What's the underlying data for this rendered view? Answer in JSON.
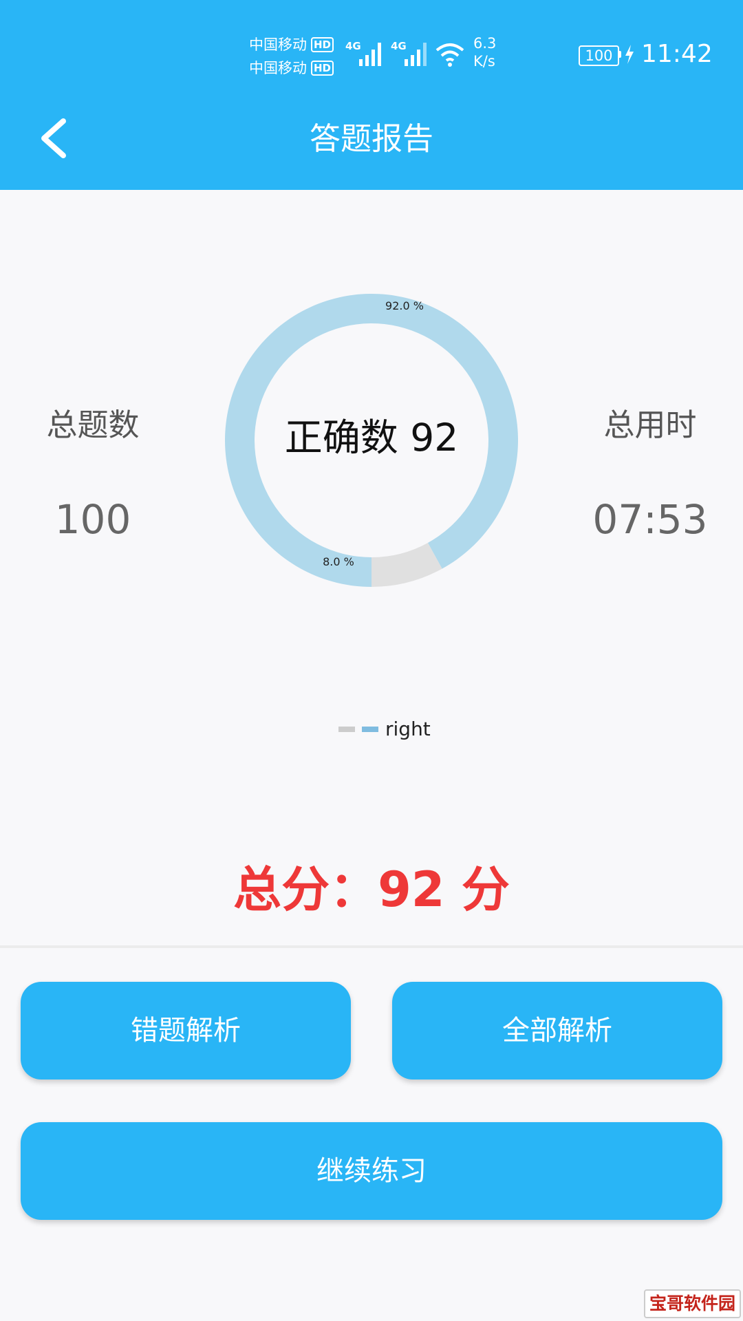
{
  "status_bar": {
    "carrier_1": "中国移动",
    "carrier_2": "中国移动",
    "hd_badge": "HD",
    "network_1": "4G",
    "network_2": "4G",
    "speed_value": "6.3",
    "speed_unit": "K/s",
    "battery": "100",
    "time": "11:42"
  },
  "header": {
    "title": "答题报告",
    "back_icon": "chevron-left-icon"
  },
  "stats": {
    "total_label": "总题数",
    "total_value": "100",
    "time_label": "总用时",
    "time_value": "07:53"
  },
  "chart_data": {
    "type": "pie",
    "center_label": "正确数 92",
    "slices": [
      {
        "label": "92.0 %",
        "value": 92.0,
        "color": "#b0d9ec"
      },
      {
        "label": "8.0 %",
        "value": 8.0,
        "color": "#e0e0e0"
      }
    ],
    "legend": {
      "label": "right",
      "swatches": [
        "#cccccc",
        "#7fbce0"
      ]
    }
  },
  "score_text": "总分：92 分",
  "buttons": {
    "wrong_analysis": "错题解析",
    "all_analysis": "全部解析",
    "continue_practice": "继续练习"
  },
  "watermark": "宝哥软件园",
  "colors": {
    "primary": "#29b5f6",
    "score": "#ee3838"
  }
}
